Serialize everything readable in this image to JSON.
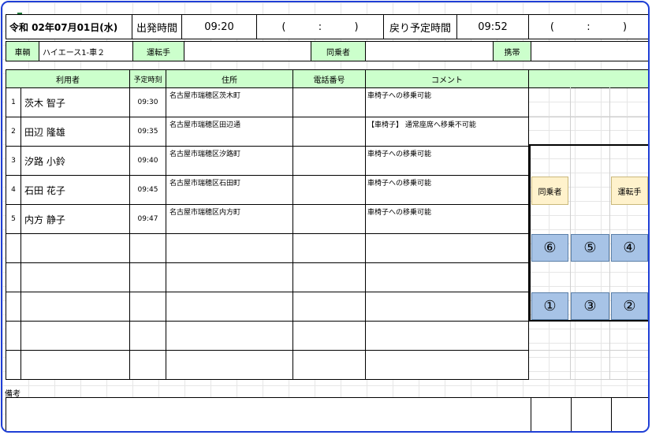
{
  "header": {
    "date": "令和 02年07月01日(水)",
    "depart_label": "出発時間",
    "depart_time": "09:20",
    "depart_paren": "(          :          )",
    "return_label": "戻り予定時間",
    "return_time": "09:52",
    "return_paren": "(          :          )"
  },
  "vehicle_row": {
    "vehicle_label": "車輌",
    "vehicle_value": "ハイエース1-車２",
    "driver_label": "運転手",
    "driver_value": "",
    "companion_label": "同乗者",
    "companion_value": "",
    "phone_label": "携帯",
    "phone_value": ""
  },
  "table": {
    "headers": {
      "user": "利用者",
      "time": "予定時刻",
      "address": "住所",
      "phone": "電話番号",
      "comment": "コメント"
    },
    "rows": [
      {
        "no": "1",
        "name": "茨木 智子",
        "time": "09:30",
        "address": "名古屋市瑞穂区茨木町",
        "phone": "",
        "comment": "車椅子への移乗可能"
      },
      {
        "no": "2",
        "name": "田辺 隆雄",
        "time": "09:35",
        "address": "名古屋市瑞穂区田辺通",
        "phone": "",
        "comment": "【車椅子】 通常座席へ移乗不可能"
      },
      {
        "no": "3",
        "name": "汐路 小鈴",
        "time": "09:40",
        "address": "名古屋市瑞穂区汐路町",
        "phone": "",
        "comment": "車椅子への移乗可能"
      },
      {
        "no": "4",
        "name": "石田 花子",
        "time": "09:45",
        "address": "名古屋市瑞穂区石田町",
        "phone": "",
        "comment": "車椅子への移乗可能"
      },
      {
        "no": "5",
        "name": "内方 静子",
        "time": "09:47",
        "address": "名古屋市瑞穂区内方町",
        "phone": "",
        "comment": "車椅子への移乗可能"
      }
    ]
  },
  "seats": {
    "companion_tag": "同乗者",
    "driver_tag": "運転手",
    "row_back": [
      "⑥",
      "⑤",
      "④"
    ],
    "row_front": [
      "①",
      "③",
      "②"
    ]
  },
  "notes": {
    "label": "備考",
    "value": ""
  },
  "colors": {
    "header_fill": "#ccffcc",
    "seat_fill": "#a7c3e6",
    "tag_fill": "#fff2cc",
    "frame": "#1f3fd6"
  }
}
